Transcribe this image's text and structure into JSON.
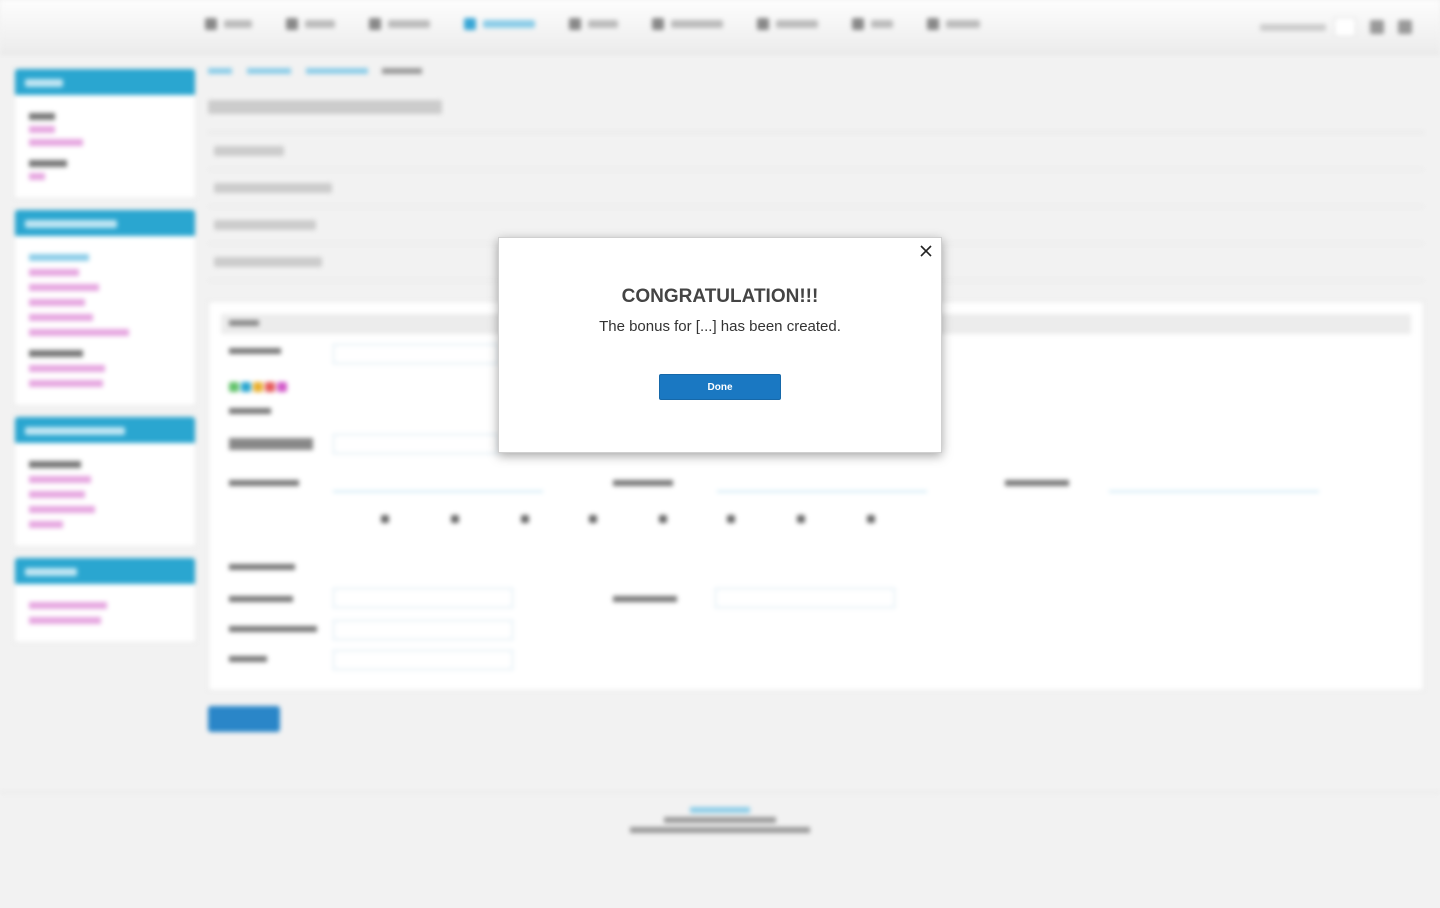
{
  "modal": {
    "title": "CONGRATULATION!!!",
    "message": "The bonus for [...] has been created.",
    "done_label": "Done"
  },
  "colors": {
    "accent": "#2aa6d0",
    "primary_button": "#1a78c2",
    "link": "#d35bc9"
  }
}
